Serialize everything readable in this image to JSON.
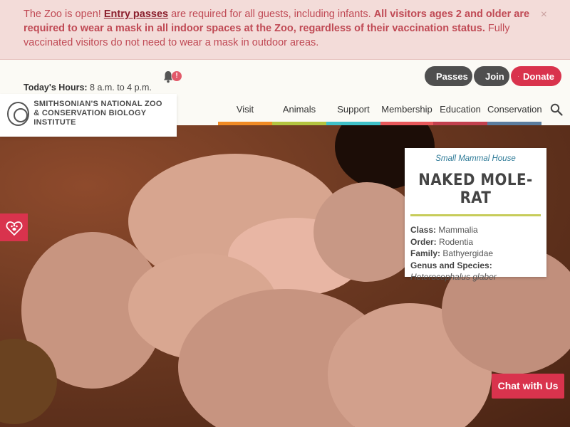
{
  "alert": {
    "t1": "The Zoo is open! ",
    "link": "Entry passes",
    "t2": " are required for all guests, including infants. ",
    "bold": "All visitors ages 2 and older are required to wear a mask in all indoor spaces at the Zoo, regardless of their vaccination status.",
    "t3": " Fully vaccinated visitors do not need to wear a mask in outdoor areas.",
    "close": "×"
  },
  "header": {
    "hours_label": "Today's Hours:",
    "hours_value": "8 a.m. to 4 p.m.",
    "notification_badge": "!",
    "logo_line1": "SMITHSONIAN'S NATIONAL ZOO",
    "logo_line2": "& CONSERVATION BIOLOGY INSTITUTE",
    "passes": "Passes",
    "join": "Join",
    "donate": "Donate"
  },
  "nav": {
    "items": [
      "Visit",
      "Animals",
      "Support",
      "Membership",
      "Education",
      "Conservation"
    ],
    "colors": [
      "#f08a24",
      "#b3c440",
      "#3fc1c9",
      "#e8585b",
      "#c2404e",
      "#5b7d9f"
    ]
  },
  "card": {
    "location": "Small Mammal House",
    "name": "NAKED MOLE-RAT",
    "class_label": "Class:",
    "class_value": "Mammalia",
    "order_label": "Order:",
    "order_value": "Rodentia",
    "family_label": "Family:",
    "family_value": "Bathyergidae",
    "genus_label": "Genus and Species:",
    "genus_value": "Heterocephalus glaber"
  },
  "chat": "Chat with Us",
  "colors": {
    "accent": "#d9334d",
    "alert_bg": "#f3dcd9",
    "alert_text": "#c04a55"
  }
}
